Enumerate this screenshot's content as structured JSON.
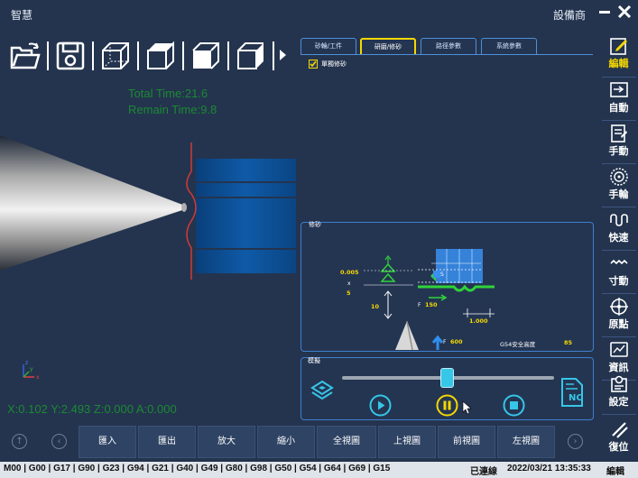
{
  "app": {
    "title": "智慧",
    "vendor": "設備商"
  },
  "tabs": [
    {
      "label": "砂輪/工件"
    },
    {
      "label": "研磨/修砂"
    },
    {
      "label": "路徑參數"
    },
    {
      "label": "系統參數"
    }
  ],
  "options": {
    "single_dress_label": "單獨修砂",
    "single_dress_checked": true
  },
  "times": {
    "total": "Total Time:21.6",
    "remain": "Remain Time:9.8"
  },
  "side_menu": [
    {
      "label": "編輯",
      "icon": "edit-icon"
    },
    {
      "label": "自動",
      "icon": "auto-icon"
    },
    {
      "label": "手動",
      "icon": "manual-icon"
    },
    {
      "label": "手輪",
      "icon": "handwheel-icon"
    },
    {
      "label": "快速",
      "icon": "rapid-icon"
    },
    {
      "label": "寸動",
      "icon": "jog-icon"
    },
    {
      "label": "原點",
      "icon": "home-origin-icon"
    },
    {
      "label": "資訊",
      "icon": "info-icon"
    },
    {
      "label": "設定",
      "icon": "settings-icon"
    },
    {
      "label": "復位",
      "icon": "reset-icon"
    }
  ],
  "dressing": {
    "title": "修砂",
    "feed_amount": "0.005",
    "x_label": "x",
    "count": "5",
    "dress_depth": "10",
    "f_label": "F",
    "feed_rate": "150",
    "pitch": "1.000",
    "s_label": "S",
    "spindle_feed": "600",
    "safe_height_label": "G54安全高度",
    "safe_height": "85"
  },
  "simulation": {
    "title": "模擬",
    "nc_label": "NC"
  },
  "coords": "X:0.102 Y:2.493 Z:0.000 A:0.000",
  "bottom_buttons": [
    "匯入",
    "匯出",
    "放大",
    "縮小",
    "全視圖",
    "上視圖",
    "前視圖",
    "左視圖"
  ],
  "gcodes": "M00 | G00 | G17 | G90 | G23 | G94 | G21 | G40 | G49 | G80 | G98 | G50 | G54 | G64 | G69 | G15",
  "status": {
    "connection": "已連線",
    "datetime": "2022/03/21 13:35:33",
    "mode": "編輯"
  },
  "colors": {
    "accent": "#f5d800",
    "panel_border": "#3f7fd0",
    "time_text": "#1b8a33",
    "grinder_blue": "#2f8ef0"
  }
}
